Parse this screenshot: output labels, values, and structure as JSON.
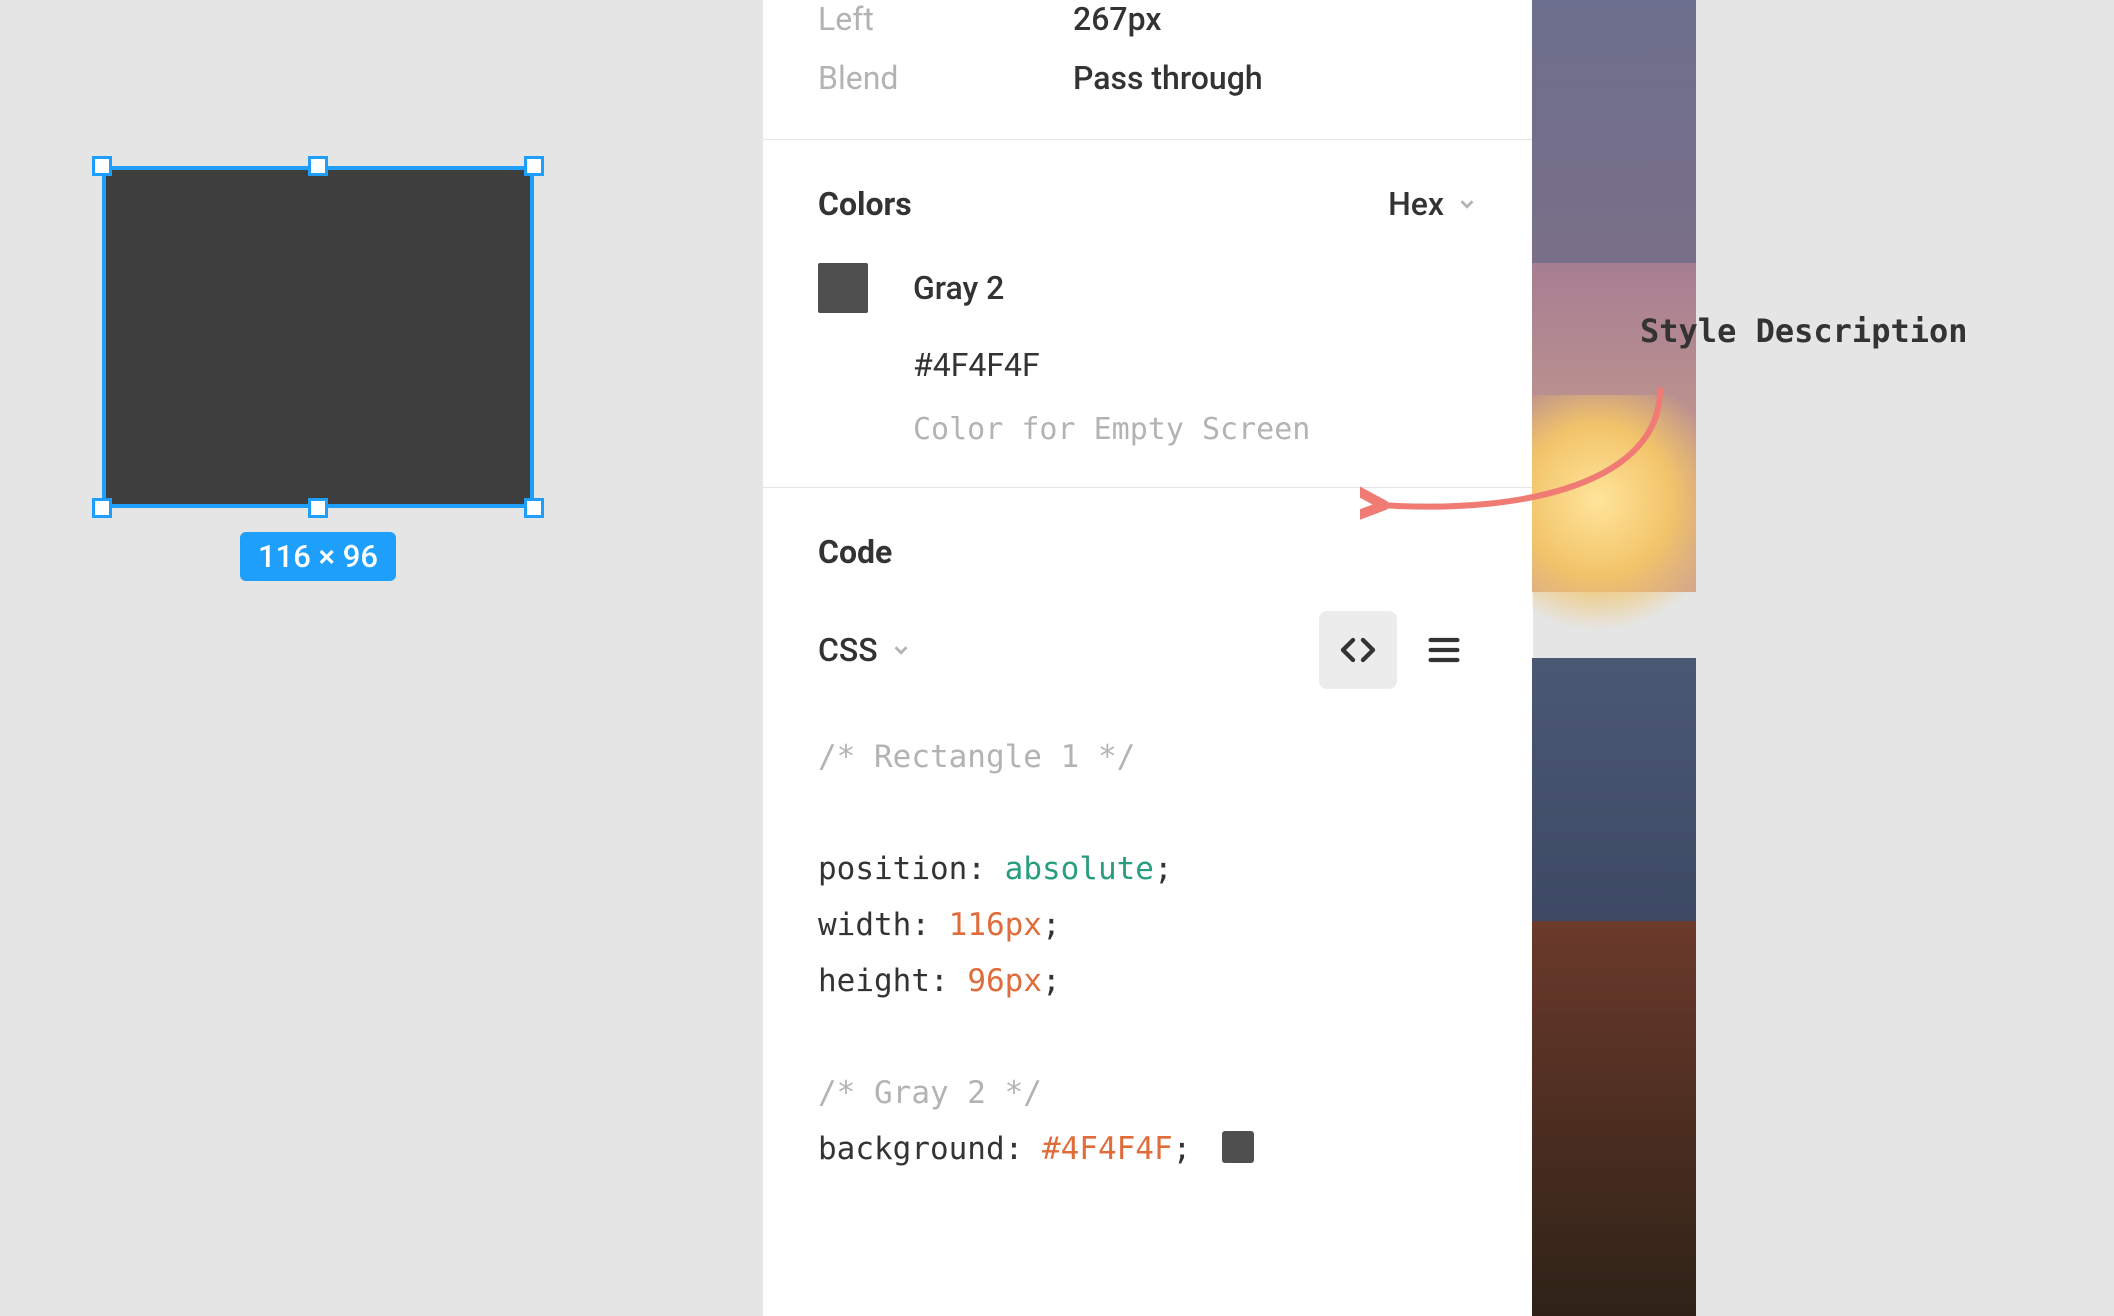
{
  "canvas": {
    "selection_dimensions": "116 × 96"
  },
  "properties": {
    "left_label": "Left",
    "left_value": "267px",
    "blend_label": "Blend",
    "blend_value": "Pass through"
  },
  "colors_section": {
    "title": "Colors",
    "format": "Hex",
    "swatch_hex": "#4F4F4F",
    "name": "Gray 2",
    "hex_row": "#4F4F4F",
    "description": "Color for Empty Screen"
  },
  "code_section": {
    "title": "Code",
    "language": "CSS",
    "comment1": "/* Rectangle 1 */",
    "lines": {
      "position_prop": "position:",
      "position_val": "absolute",
      "width_prop": "width:",
      "width_val": "116px",
      "height_prop": "height:",
      "height_val": "96px"
    },
    "comment2": "/* Gray 2 */",
    "bg_prop": "background:",
    "bg_val": "#4F4F4F"
  },
  "annotation": {
    "label": "Style Description"
  }
}
